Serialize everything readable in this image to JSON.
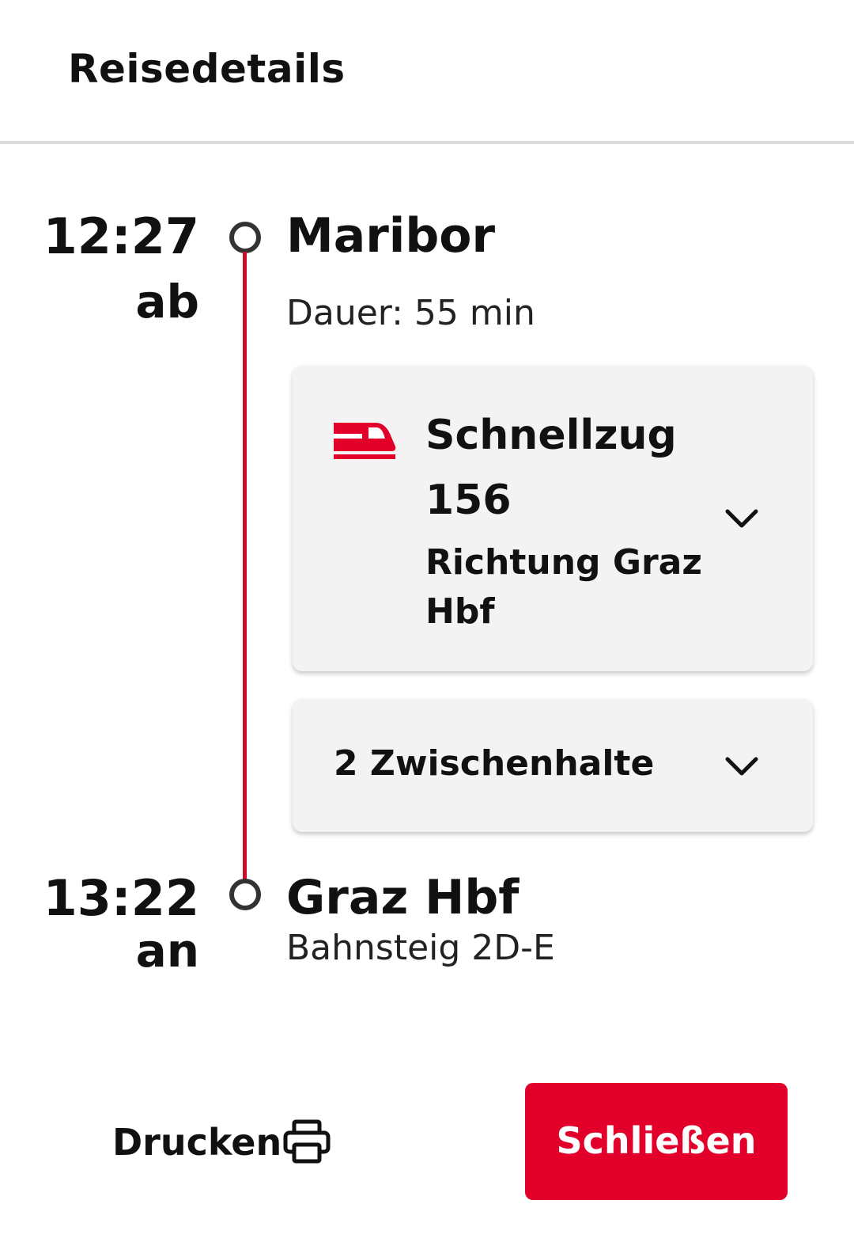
{
  "header": {
    "title": "Reisedetails"
  },
  "departure": {
    "time": "12:27",
    "label": "ab",
    "station": "Maribor",
    "duration": "Dauer: 55 min"
  },
  "train": {
    "icon": "train-icon",
    "name": "Schnellzug",
    "number": "156",
    "direction": "Richtung Graz Hbf"
  },
  "stops": {
    "label": "2 Zwischenhalte"
  },
  "arrival": {
    "time": "13:22",
    "label": "an",
    "station": "Graz Hbf",
    "platform": "Bahnsteig 2D-E"
  },
  "footer": {
    "print_label": "Drucken",
    "close_label": "Schließen"
  },
  "colors": {
    "accent": "#e2002a",
    "timeline": "#c8102e",
    "card_bg": "#f3f3f3"
  }
}
